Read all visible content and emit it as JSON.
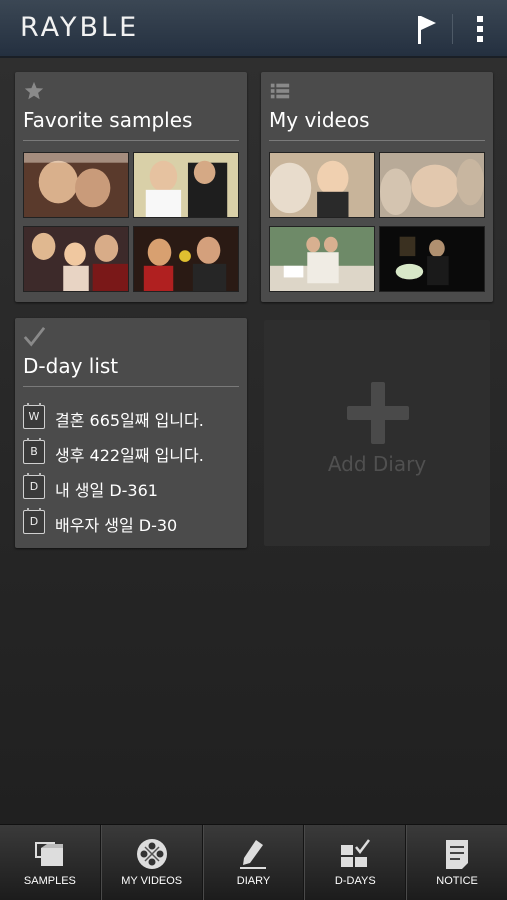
{
  "app": {
    "logo": "RAYBLE"
  },
  "toolbar": {
    "flag_icon": "flag-icon",
    "menu_icon": "overflow-menu-icon"
  },
  "cards": {
    "favorites": {
      "icon": "star-icon",
      "title": "Favorite samples"
    },
    "videos": {
      "icon": "list-icon",
      "title": "My videos"
    },
    "dday": {
      "icon": "checkmark-icon",
      "title": "D-day list",
      "items": [
        {
          "badge": "W",
          "text": "결혼 665일째 입니다."
        },
        {
          "badge": "B",
          "text": "생후 422일째 입니다."
        },
        {
          "badge": "D",
          "text": "내 생일 D-361"
        },
        {
          "badge": "D",
          "text": "배우자 생일 D-30"
        }
      ]
    },
    "add_diary": {
      "icon": "plus-icon",
      "label": "Add Diary"
    }
  },
  "bottom_nav": [
    {
      "icon": "samples-icon",
      "label": "SAMPLES"
    },
    {
      "icon": "film-reel-icon",
      "label": "MY VIDEOS"
    },
    {
      "icon": "pencil-icon",
      "label": "DIARY"
    },
    {
      "icon": "calendar-check-icon",
      "label": "D-DAYS"
    },
    {
      "icon": "notice-icon",
      "label": "NOTICE"
    }
  ],
  "colors": {
    "card_bg": "#4b4b4b",
    "topbar": "#2f3b49",
    "background": "#262626"
  }
}
